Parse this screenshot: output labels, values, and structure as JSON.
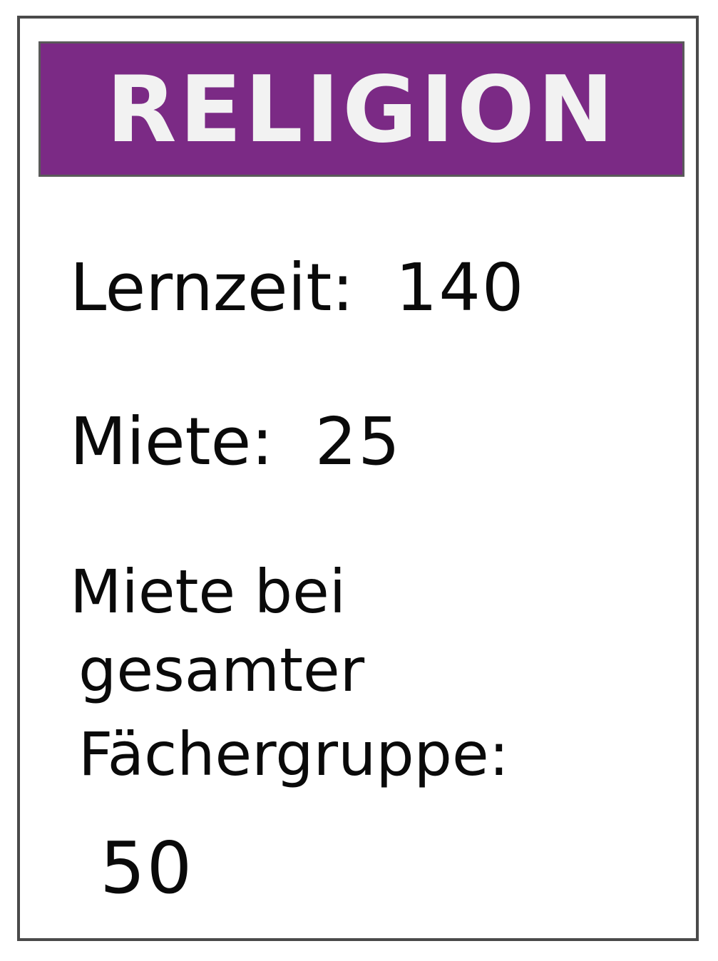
{
  "card": {
    "title": "RELIGION",
    "title_bar_color": "#7b2a85",
    "lernzeit_label": "Lernzeit:",
    "lernzeit_value": "140",
    "miete_label": "Miete:",
    "miete_value": "25",
    "gruppe_label_line1": "Miete bei",
    "gruppe_label_line2": "gesamter",
    "gruppe_label_line3": "Fächergruppe:",
    "gruppe_value": "50"
  }
}
